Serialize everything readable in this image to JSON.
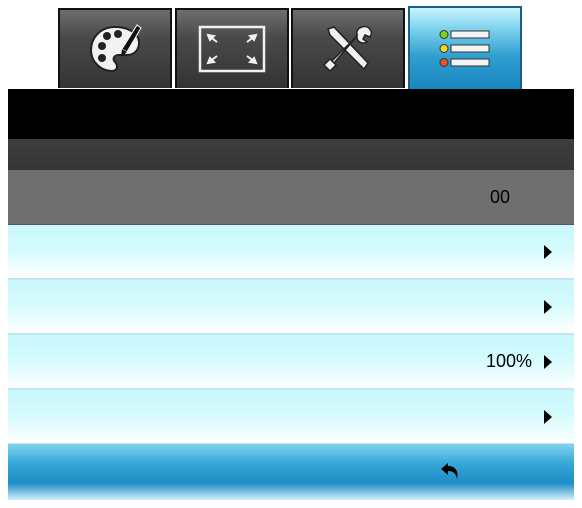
{
  "tabs": [
    {
      "icon": "palette-icon",
      "active": false
    },
    {
      "icon": "display-resize-icon",
      "active": false
    },
    {
      "icon": "tools-icon",
      "active": false
    },
    {
      "icon": "list-menu-icon",
      "active": true
    }
  ],
  "menu": {
    "selected_row": {
      "value": "00"
    },
    "rows": [
      {
        "value": ""
      },
      {
        "value": ""
      },
      {
        "value": "100%"
      },
      {
        "value": ""
      }
    ]
  },
  "footer": {
    "back_icon": "back-arrow-icon"
  },
  "colors": {
    "accent": "#1f8dc6",
    "row_light": "#d4fbfd",
    "selected": "#6f6f6f"
  }
}
